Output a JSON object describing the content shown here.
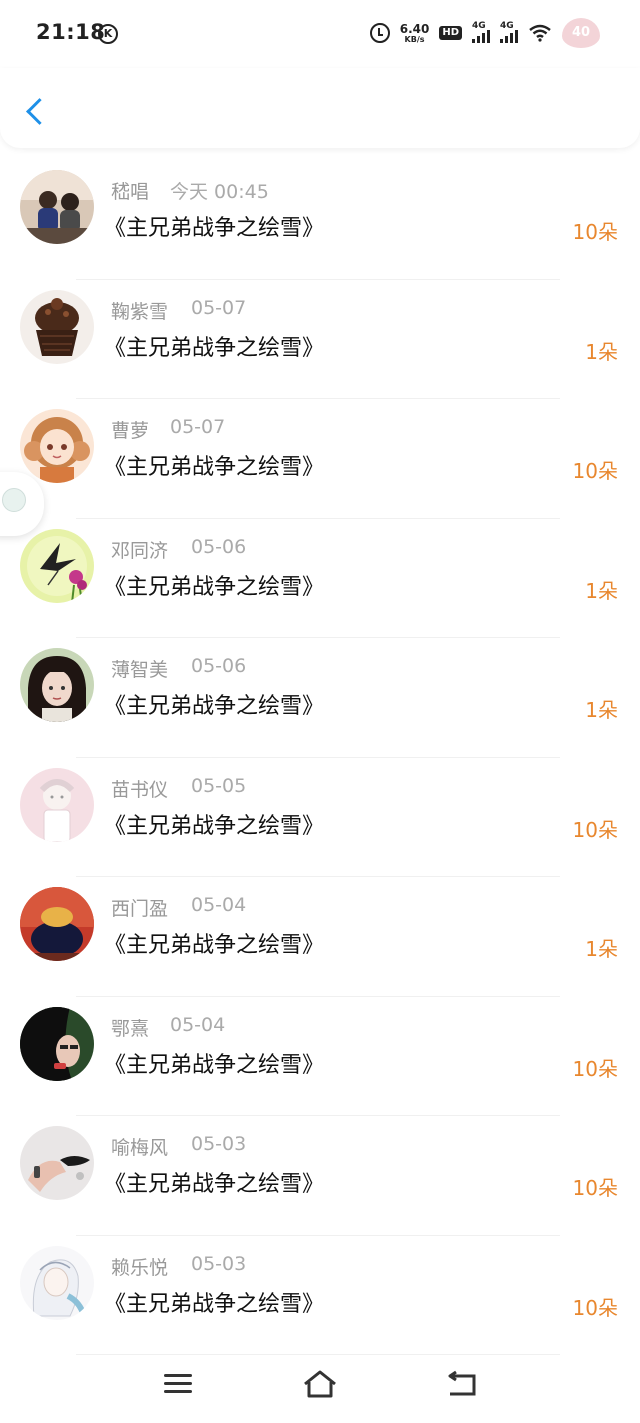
{
  "status_bar": {
    "time": "21:18",
    "k_badge": "K",
    "net_speed_value": "6.40",
    "net_speed_unit": "KB/s",
    "hd_label": "HD",
    "sim1_label": "4G",
    "sim2_label": "4G",
    "battery": "40"
  },
  "header": {
    "back_icon": "chevron-left-icon",
    "accent_color": "#1e90e8"
  },
  "list": {
    "amount_color": "#e8872e",
    "items": [
      {
        "name": "嵇唱",
        "date": "今天 00:45",
        "title": "《主兄弟战争之绘雪》",
        "amount": "10朵"
      },
      {
        "name": "鞠紫雪",
        "date": "05-07",
        "title": "《主兄弟战争之绘雪》",
        "amount": "1朵"
      },
      {
        "name": "曹萝",
        "date": "05-07",
        "title": "《主兄弟战争之绘雪》",
        "amount": "10朵"
      },
      {
        "name": "邓同济",
        "date": "05-06",
        "title": "《主兄弟战争之绘雪》",
        "amount": "1朵"
      },
      {
        "name": "薄智美",
        "date": "05-06",
        "title": "《主兄弟战争之绘雪》",
        "amount": "1朵"
      },
      {
        "name": "苗书仪",
        "date": "05-05",
        "title": "《主兄弟战争之绘雪》",
        "amount": "10朵"
      },
      {
        "name": "西门盈",
        "date": "05-04",
        "title": "《主兄弟战争之绘雪》",
        "amount": "1朵"
      },
      {
        "name": "鄂熹",
        "date": "05-04",
        "title": "《主兄弟战争之绘雪》",
        "amount": "10朵"
      },
      {
        "name": "喻梅风",
        "date": "05-03",
        "title": "《主兄弟战争之绘雪》",
        "amount": "10朵"
      },
      {
        "name": "赖乐悦",
        "date": "05-03",
        "title": "《主兄弟战争之绘雪》",
        "amount": "10朵"
      }
    ]
  },
  "nav_bar": {
    "menu_icon": "menu-icon",
    "home_icon": "home-icon",
    "back_icon": "back-icon"
  }
}
